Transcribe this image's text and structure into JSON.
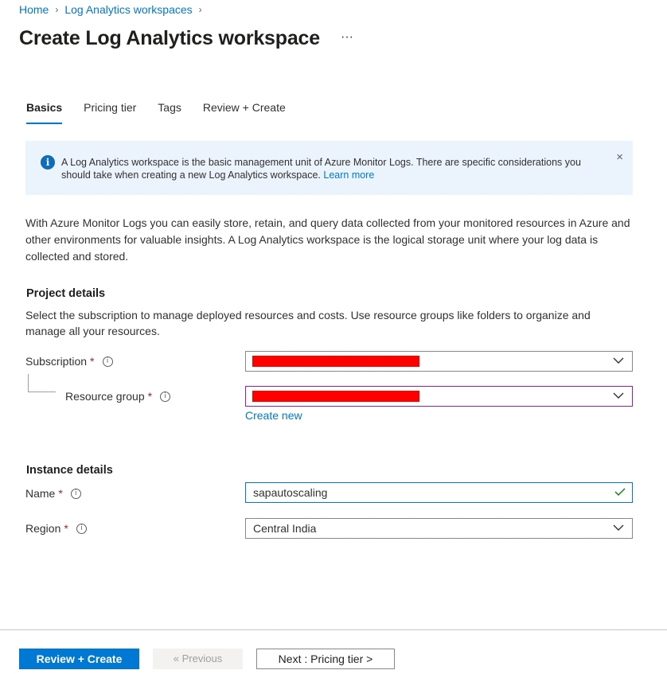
{
  "breadcrumb": {
    "home": "Home",
    "parent": "Log Analytics workspaces",
    "sep": "›"
  },
  "page": {
    "title": "Create Log Analytics workspace",
    "more": "···"
  },
  "tabs": [
    {
      "label": "Basics",
      "active": true
    },
    {
      "label": "Pricing tier",
      "active": false
    },
    {
      "label": "Tags",
      "active": false
    },
    {
      "label": "Review + Create",
      "active": false
    }
  ],
  "infobar": {
    "text": "A Log Analytics workspace is the basic management unit of Azure Monitor Logs. There are specific considerations you should take when creating a new Log Analytics workspace.",
    "link": "Learn more",
    "close": "×",
    "icon": "info-icon"
  },
  "description": "With Azure Monitor Logs you can easily store, retain, and query data collected from your monitored resources in Azure and other environments for valuable insights. A Log Analytics workspace is the logical storage unit where your log data is collected and stored.",
  "project": {
    "heading": "Project details",
    "description": "Select the subscription to manage deployed resources and costs. Use resource groups like folders to organize and manage all your resources.",
    "subscription": {
      "label": "Subscription",
      "required": "*",
      "value": ""
    },
    "resource_group": {
      "label": "Resource group",
      "required": "*",
      "value": "",
      "create_new": "Create new"
    }
  },
  "instance": {
    "heading": "Instance details",
    "name": {
      "label": "Name",
      "required": "*",
      "value": "sapautoscaling"
    },
    "region": {
      "label": "Region",
      "required": "*",
      "value": "Central India"
    }
  },
  "footer": {
    "review_create": "Review + Create",
    "previous": "« Previous",
    "next": "Next : Pricing tier >"
  },
  "colors": {
    "accent": "#0078d4",
    "required": "#a4262c",
    "info_bg": "#ebf3fc",
    "redaction": "#ff0000",
    "valid": "#107c10"
  }
}
